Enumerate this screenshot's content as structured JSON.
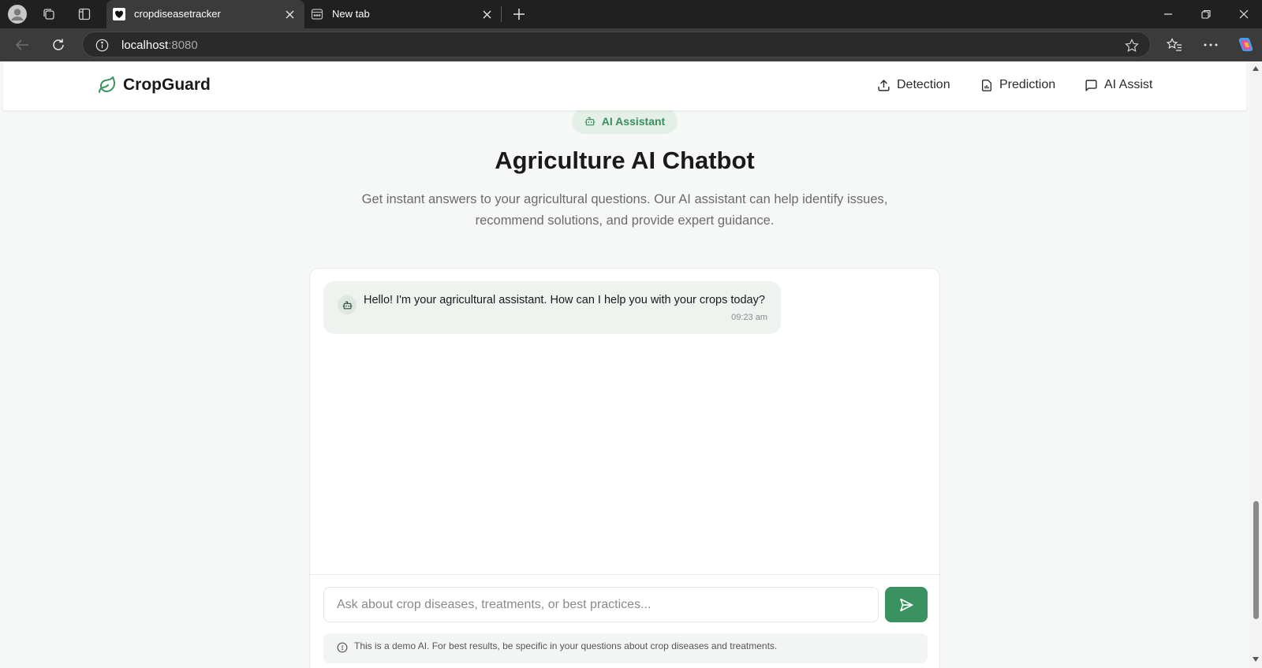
{
  "browser": {
    "tabs": [
      {
        "title": "cropdiseasetracker",
        "active": true
      },
      {
        "title": "New tab",
        "active": false
      }
    ],
    "address": {
      "host": "localhost",
      "port": ":8080"
    }
  },
  "site": {
    "brand": "CropGuard",
    "nav": [
      {
        "label": "Detection",
        "icon": "upload-icon"
      },
      {
        "label": "Prediction",
        "icon": "file-chart-icon"
      },
      {
        "label": "AI Assist",
        "icon": "message-square-icon"
      }
    ],
    "accent_color": "#3a9260"
  },
  "hero": {
    "badge": "AI Assistant",
    "title": "Agriculture AI Chatbot",
    "subtitle": "Get instant answers to your agricultural questions. Our AI assistant can help identify issues, recommend solutions, and provide expert guidance."
  },
  "chat": {
    "messages": [
      {
        "sender": "bot",
        "text": "Hello! I'm your agricultural assistant. How can I help you with your crops today?",
        "time": "09:23 am"
      }
    ],
    "input": {
      "placeholder": "Ask about crop diseases, treatments, or best practices...",
      "value": ""
    },
    "notice": "This is a demo AI. For best results, be specific in your questions about crop diseases and treatments."
  }
}
